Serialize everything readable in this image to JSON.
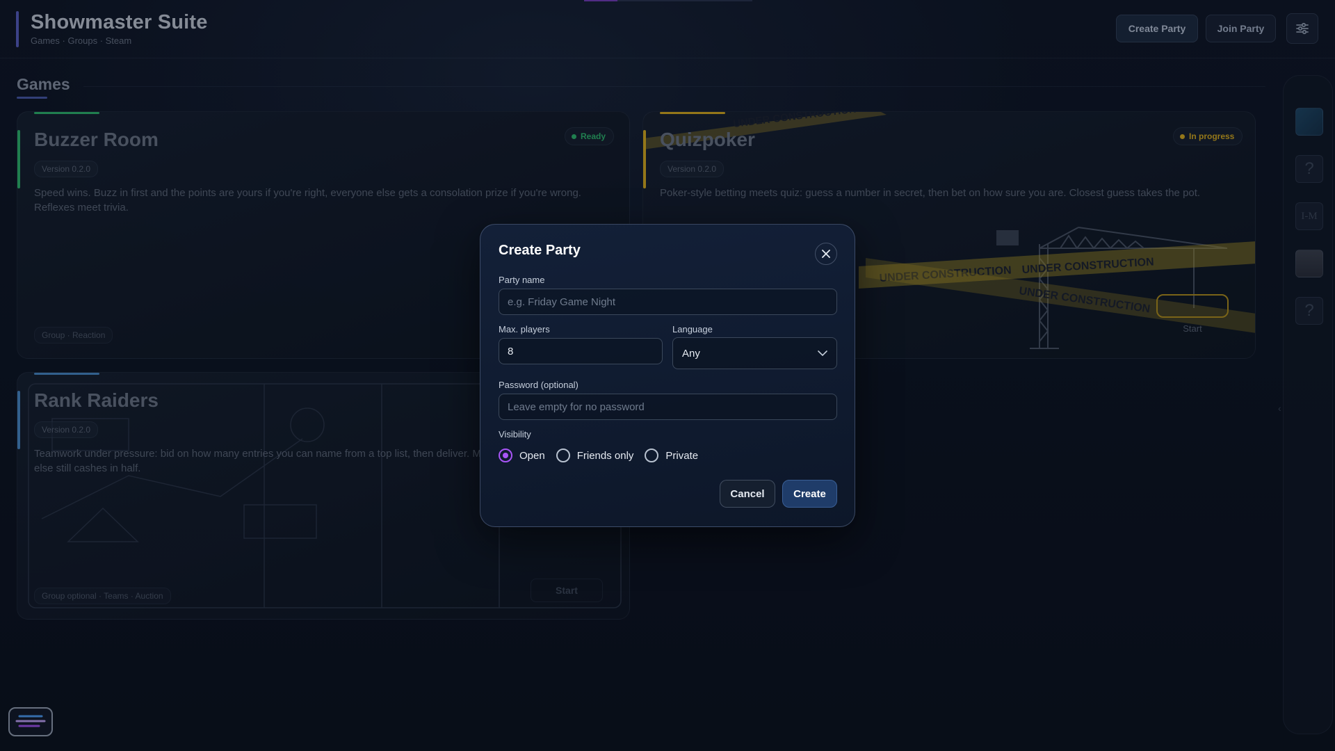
{
  "header": {
    "title": "Showmaster Suite",
    "subtitle": "Games · Groups · Steam",
    "create_party": "Create Party",
    "join_party": "Join Party",
    "settings_icon": "sliders-icon"
  },
  "games_section": {
    "title": "Games"
  },
  "cards": [
    {
      "title": "Buzzer Room",
      "version": "Version 0.2.0",
      "status": "Ready",
      "status_color": "#2fbf71",
      "description": "Speed wins. Buzz in first and the points are yours if you're right, everyone else gets a consolation prize if you're wrong. Reflexes meet trivia.",
      "tags": "Group · Reaction",
      "accent": "#2fbf71"
    },
    {
      "title": "Quizpoker",
      "version": "Version 0.2.0",
      "status": "In progress",
      "status_color": "#e0b21e",
      "description": "Poker-style betting meets quiz: guess a number in secret, then bet on how sure you are. Closest guess takes the pot.",
      "start_label": "Start",
      "construction_text": "UNDER CONSTRUCTION",
      "accent": "#e0b21e"
    },
    {
      "title": "Rank Raiders",
      "version": "Version 0.2.0",
      "description": "Teamwork under pressure: bid on how many entries you can name from a top list, then deliver. Mi",
      "description_line2": "else still cashes in half.",
      "tags": "Group optional · Teams · Auction",
      "start_label": "Start",
      "accent": "#4a8fd0"
    }
  ],
  "top_progress": 0.2,
  "modal": {
    "title": "Create Party",
    "party_name_label": "Party name",
    "party_name_placeholder": "e.g. Friday Game Night",
    "max_players_label": "Max. players",
    "max_players_value": "8",
    "language_label": "Language",
    "language_value": "Any",
    "password_label": "Password (optional)",
    "password_placeholder": "Leave empty for no password",
    "visibility_label": "Visibility",
    "visibility_options": [
      "Open",
      "Friends only",
      "Private"
    ],
    "visibility_selected": "Open",
    "cancel": "Cancel",
    "create": "Create"
  },
  "rail": {
    "slots": [
      "thumbnail-1",
      "question-mark-icon",
      "monogram-logo",
      "portrait-thumbnail",
      "question-mark-icon"
    ],
    "unknown_glyph": "?",
    "monogram_text": "I-M"
  },
  "accent_purple": "#a855f7"
}
